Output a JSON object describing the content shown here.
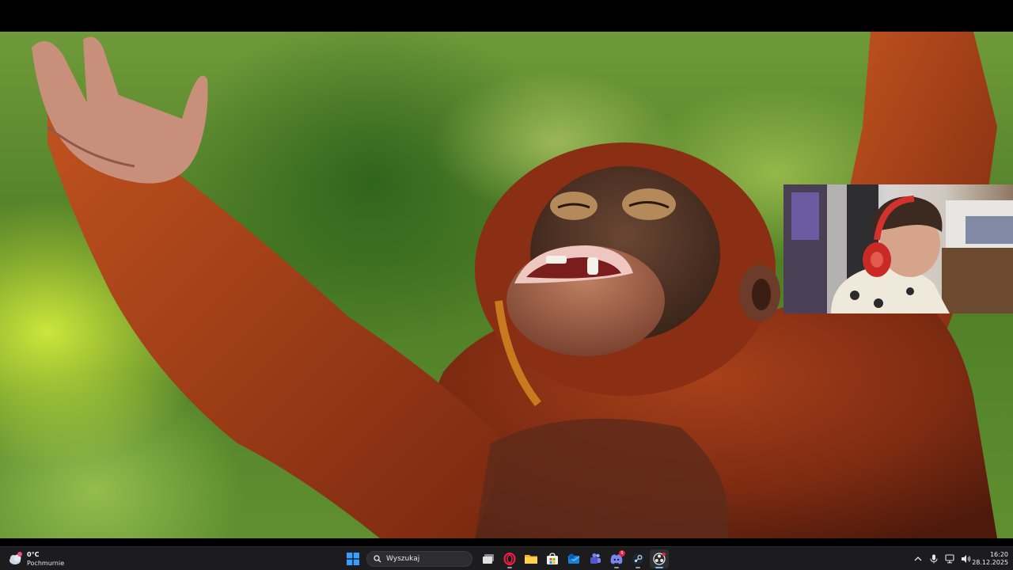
{
  "taskbar": {
    "weather": {
      "temperature": "0°C",
      "condition": "Pochmurnie",
      "icon": "cloud-icon"
    },
    "search": {
      "placeholder": "Wyszukaj"
    },
    "apps": [
      {
        "name": "start-button",
        "icon": "windows-logo-icon"
      },
      {
        "name": "task-view-button",
        "icon": "task-view-icon"
      },
      {
        "name": "opera-gx-button",
        "icon": "opera-icon"
      },
      {
        "name": "file-explorer-button",
        "icon": "folder-icon"
      },
      {
        "name": "microsoft-store-button",
        "icon": "store-icon"
      },
      {
        "name": "outlook-button",
        "icon": "mail-icon"
      },
      {
        "name": "teams-button",
        "icon": "teams-icon"
      },
      {
        "name": "discord-button",
        "icon": "discord-icon",
        "badge": "9"
      },
      {
        "name": "steam-button",
        "icon": "steam-icon"
      },
      {
        "name": "obs-button",
        "icon": "obs-icon"
      }
    ],
    "tray": {
      "overflow_icon": "chevron-up-icon",
      "mic_icon": "microphone-icon",
      "network_icon": "network-icon",
      "volume_icon": "speaker-icon"
    },
    "clock": {
      "time": "16:20",
      "date": "28.12.2025"
    }
  },
  "colors": {
    "taskbar_bg": "#1c1c1e",
    "accent_blue": "#3b9cff",
    "badge_red": "#e81e3a",
    "fur_orange": "#b8461a"
  }
}
